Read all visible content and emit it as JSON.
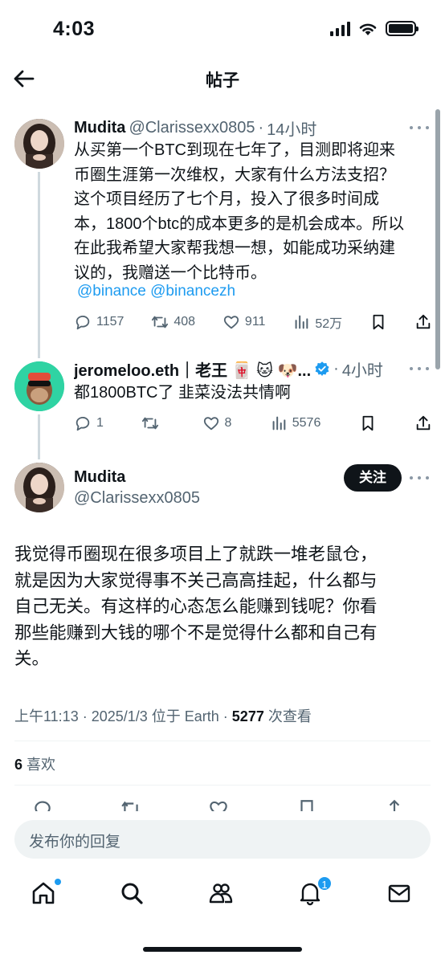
{
  "status_bar": {
    "time": "4:03"
  },
  "header": {
    "title": "帖子"
  },
  "tweet1": {
    "name": "Mudita",
    "handle": "@Clarissexx0805",
    "sep": "·",
    "when": "14小时",
    "lines": [
      "从买第一个BTC到现在七年了，目测即将迎来",
      "币圈生涯第一次维权，大家有什么方法支招？",
      "这个项目经历了七个月，投入了很多时间成",
      "本，1800个btc的成本更多的是机会成本。所以",
      "在此我希望大家帮我想一想，如能成功采纳建",
      "议的，我赠送一个比特币。"
    ],
    "mentions": "@binance @binancezh",
    "replies": "1157",
    "reposts": "408",
    "likes": "911",
    "views": "52万"
  },
  "tweet2": {
    "name": "jeromeloo.eth｜老王 🀄 🐱 🐶...",
    "sep": "·",
    "when": "4小时",
    "text": "都1800BTC了 韭菜没法共情啊",
    "replies": "1",
    "reposts": "",
    "likes": "8",
    "views": "5576"
  },
  "focus": {
    "name": "Mudita",
    "handle": "@Clarissexx0805",
    "follow_label": "关注",
    "lines": [
      "我觉得币圈现在很多项目上了就跌一堆老鼠仓，",
      "就是因为大家觉得事不关己高高挂起，什么都与",
      "自己无关。有这样的心态怎么能赚到钱呢？你看",
      "那些能赚到大钱的哪个不是觉得什么都和自己有",
      "关。"
    ],
    "meta_prefix": "上午11:13 · 2025/1/3 位于 Earth · ",
    "view_count": "5277",
    "view_suffix": " 次查看",
    "like_count": "6",
    "like_label": " 喜欢"
  },
  "reply": {
    "placeholder": "发布你的回复"
  },
  "tabbar": {
    "notifications_badge": "1"
  },
  "colors": {
    "accent": "#1d9bf0",
    "text": "#0f1419",
    "muted": "#536471"
  }
}
